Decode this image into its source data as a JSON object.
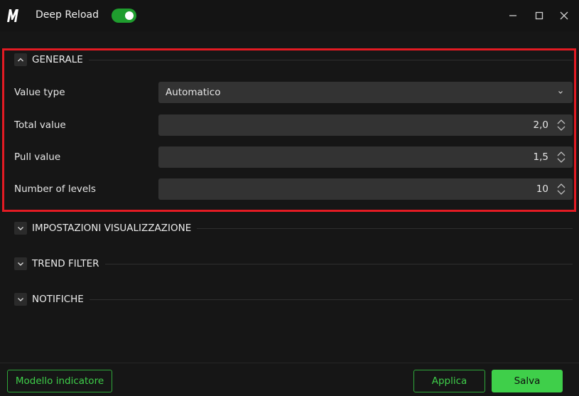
{
  "app": {
    "title": "Deep Reload",
    "enabled": true
  },
  "sections": [
    {
      "title": "GENERALE",
      "expanded": true
    },
    {
      "title": "IMPOSTAZIONI VISUALIZZAZIONE",
      "expanded": false
    },
    {
      "title": "TREND FILTER",
      "expanded": false
    },
    {
      "title": "NOTIFICHE",
      "expanded": false
    }
  ],
  "fields": {
    "value_type": {
      "label": "Value type",
      "value": "Automatico"
    },
    "total_value": {
      "label": "Total value",
      "value": "2,0"
    },
    "pull_value": {
      "label": "Pull value",
      "value": "1,5"
    },
    "number_of_levels": {
      "label": "Number of levels",
      "value": "10"
    }
  },
  "footer": {
    "template_label": "Modello indicatore",
    "apply_label": "Applica",
    "save_label": "Salva"
  },
  "colors": {
    "accent": "#3fcf4a",
    "highlight": "#e31b23",
    "background": "#161616",
    "control": "#333333"
  }
}
